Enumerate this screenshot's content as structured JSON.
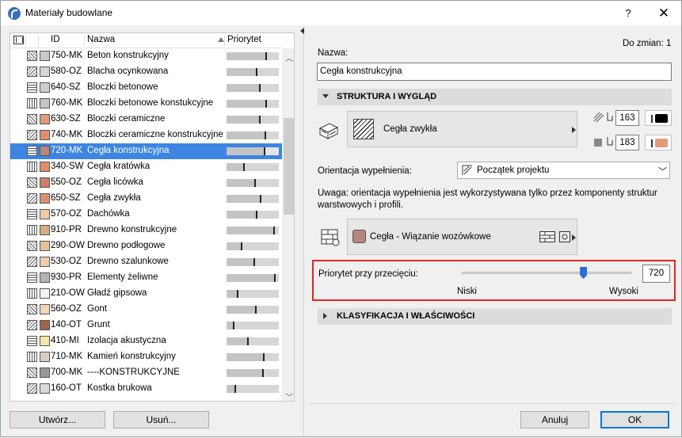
{
  "window": {
    "title": "Materiały budowlane",
    "help_label": "?",
    "close_label": "✕"
  },
  "list": {
    "columns": {
      "id": "ID",
      "name": "Nazwa",
      "priority": "Priorytet"
    },
    "rows": [
      {
        "id": "750-MK",
        "name": "Beton konstrukcyjny",
        "color": "#c9c9c9",
        "fill": 0.76
      },
      {
        "id": "580-OZ",
        "name": "Blacha ocynkowana",
        "color": "#d5d5d5",
        "fill": 0.58
      },
      {
        "id": "640-SZ",
        "name": "Bloczki betonowe",
        "color": "#cfcfcf",
        "fill": 0.64
      },
      {
        "id": "760-MK",
        "name": "Bloczki betonowe konstukcyjne",
        "color": "#c4c4c4",
        "fill": 0.76
      },
      {
        "id": "630-SZ",
        "name": "Bloczki ceramiczne",
        "color": "#e09a80",
        "fill": 0.63
      },
      {
        "id": "740-MK",
        "name": "Bloczki ceramiczne konstrukcyjne",
        "color": "#de8f72",
        "fill": 0.74
      },
      {
        "id": "720-MK",
        "name": "Cegła konstrukcyjna",
        "color": "#b8877b",
        "fill": 0.72
      },
      {
        "id": "340-SW",
        "name": "Cegła kratówka",
        "color": "#e08e6e",
        "fill": 0.34
      },
      {
        "id": "550-OZ",
        "name": "Cegła licówka",
        "color": "#cc7f6a",
        "fill": 0.55
      },
      {
        "id": "650-SZ",
        "name": "Cegła zwykła",
        "color": "#d99072",
        "fill": 0.65
      },
      {
        "id": "570-OZ",
        "name": "Dachówka",
        "color": "#f2c9a5",
        "fill": 0.57
      },
      {
        "id": "910-PR",
        "name": "Drewno konstrukcyjne",
        "color": "#d6ad86",
        "fill": 0.91
      },
      {
        "id": "290-OW",
        "name": "Drewno podłogowe",
        "color": "#e4c29d",
        "fill": 0.29
      },
      {
        "id": "530-OZ",
        "name": "Drewno szalunkowe",
        "color": "#ead0ad",
        "fill": 0.53
      },
      {
        "id": "930-PR",
        "name": "Elementy żeliwne",
        "color": "#b4b4b4",
        "fill": 0.93
      },
      {
        "id": "210-OW",
        "name": "Gładź gipsowa",
        "color": "#f3f3f3",
        "fill": 0.21
      },
      {
        "id": "560-OZ",
        "name": "Gont",
        "color": "#f1d7b7",
        "fill": 0.56
      },
      {
        "id": "140-OT",
        "name": "Grunt",
        "color": "#a0644c",
        "fill": 0.14
      },
      {
        "id": "410-MI",
        "name": "Izolacja akustyczna",
        "color": "#f4e9a6",
        "fill": 0.41
      },
      {
        "id": "710-MK",
        "name": "Kamień konstrukcyjny",
        "color": "#d8cfc3",
        "fill": 0.71
      },
      {
        "id": "700-MK",
        "name": "----KONSTRUKCYJNE",
        "color": "#9a9a9a",
        "fill": 0.7
      },
      {
        "id": "160-OT",
        "name": "Kostka brukowa",
        "color": "#d9d9d9",
        "fill": 0.16
      }
    ],
    "selected_index": 6
  },
  "buttons": {
    "create": "Utwórz...",
    "delete": "Usuń...",
    "cancel": "Anuluj",
    "ok": "OK"
  },
  "details": {
    "changes_label": "Do zmian: 1",
    "name_label": "Nazwa:",
    "name_value": "Cegła konstrukcyjna",
    "section_structure": "STRUKTURA I WYGLĄD",
    "fill_name": "Cegła zwykła",
    "pen_fg": "163",
    "pen_bg": "183",
    "pen_fg_color": "#000000",
    "pen_bg_color": "#e49a78",
    "orientation_label": "Orientacja wypełnienia:",
    "orientation_value": "Początek projektu",
    "note": "Uwaga: orientacja wypełnienia jest wykorzystywana tylko przez komponenty struktur warstwowych i profili.",
    "surface_name": "Cegła - Wiązanie wozówkowe",
    "surface_color": "#b8877b",
    "priority_label": "Priorytet przy przecięciu:",
    "priority_value": "720",
    "priority_fraction": 0.72,
    "low_label": "Niski",
    "high_label": "Wysoki",
    "section_classification": "KLASYFIKACJA I WŁAŚCIWOŚCI"
  }
}
